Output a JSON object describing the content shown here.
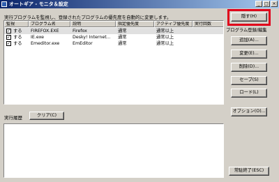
{
  "window": {
    "title": "オートギア - モニタ＆設定",
    "minimize": "_",
    "maximize": "□",
    "close": "×"
  },
  "info_text": "実行プログラムを監視し、登録されたプログラムの優先度を自動的に変更します。",
  "table": {
    "columns": [
      "監視",
      "プログラム名",
      "説明",
      "指定優先度",
      "アクティブ優先度",
      "実行回数"
    ],
    "rows": [
      {
        "watch": "する",
        "checked": true,
        "program": "FIREFOX.EXE",
        "description": "Firefox",
        "priority": "通常",
        "active_priority": "通常以上",
        "count": ""
      },
      {
        "watch": "する",
        "checked": true,
        "program": "IE.exe",
        "description": "Desky! Internet...",
        "priority": "通常",
        "active_priority": "通常以上",
        "count": ""
      },
      {
        "watch": "する",
        "checked": true,
        "program": "Emeditor.exe",
        "description": "EmEditor",
        "priority": "通常",
        "active_priority": "通常以上",
        "count": ""
      }
    ]
  },
  "history": {
    "label": "実行履歴",
    "clear": "クリア(C)"
  },
  "buttons": {
    "hide": "隠す(H)",
    "group_label": "プログラム登録/編集",
    "add": "追加(A)...",
    "edit": "変更(E)...",
    "delete": "削除(D)...",
    "save": "セーブ(S)",
    "load": "ロード(L)",
    "options": "オプション(O)...",
    "exit": "常駐終了(ESC)"
  },
  "colors": {
    "highlight": "#e0001a",
    "titlebar": "#0a246a"
  }
}
